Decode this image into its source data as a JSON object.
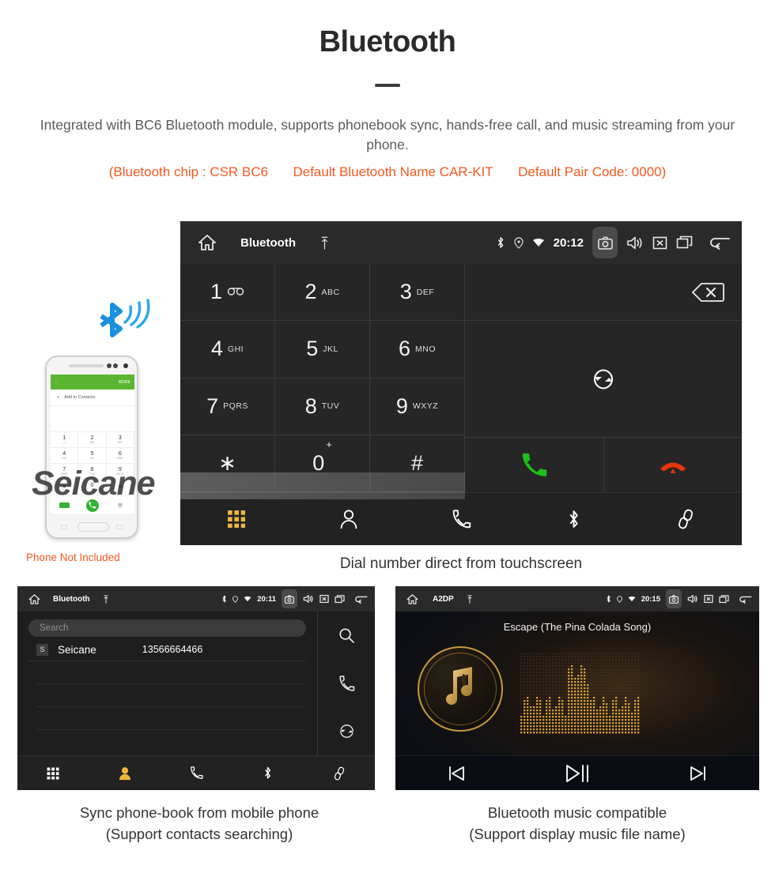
{
  "header": {
    "title": "Bluetooth",
    "description": "Integrated with BC6 Bluetooth module, supports phonebook sync, hands-free call, and music streaming from your phone.",
    "spec_chip": "(Bluetooth chip : CSR BC6",
    "spec_name": "Default Bluetooth Name CAR-KIT",
    "spec_code": "Default Pair Code: 0000)",
    "accent_color": "#f4581f",
    "title_color": "#2b2b2b"
  },
  "phone_mock": {
    "appbar_back": "←",
    "appbar_more": "MORE",
    "add_contacts": "Add to Contacts",
    "add_plus": "+",
    "keys": [
      {
        "num": "1",
        "sub": "∞"
      },
      {
        "num": "2",
        "sub": "ABC"
      },
      {
        "num": "3",
        "sub": "DEF"
      },
      {
        "num": "4",
        "sub": "GHI"
      },
      {
        "num": "5",
        "sub": "JKL"
      },
      {
        "num": "6",
        "sub": "MNO"
      },
      {
        "num": "7",
        "sub": "PQRS"
      },
      {
        "num": "8",
        "sub": "TUV"
      },
      {
        "num": "9",
        "sub": "WXYZ"
      },
      {
        "num": "∗",
        "sub": ""
      },
      {
        "num": "0",
        "sub": "+"
      },
      {
        "num": "#",
        "sub": ""
      }
    ],
    "not_included_note": "Phone Not Included",
    "bluetooth_wave_icon": "bluetooth-signal-icon"
  },
  "dialer": {
    "statusbar": {
      "home_icon": "home-icon",
      "title": "Bluetooth",
      "usb_icon": "usb-icon",
      "bluetooth_icon": "bluetooth-icon",
      "location_icon": "location-icon",
      "wifi_icon": "wifi-icon",
      "time": "20:12",
      "camera_icon": "camera-icon",
      "volume_icon": "volume-icon",
      "close_icon": "close-box-icon",
      "recents_icon": "recents-icon",
      "back_icon": "back-icon"
    },
    "keys": [
      {
        "num": "1",
        "sub": "",
        "voicemail": true
      },
      {
        "num": "2",
        "sub": "ABC"
      },
      {
        "num": "3",
        "sub": "DEF"
      },
      {
        "num": "4",
        "sub": "GHI"
      },
      {
        "num": "5",
        "sub": "JKL"
      },
      {
        "num": "6",
        "sub": "MNO"
      },
      {
        "num": "7",
        "sub": "PQRS"
      },
      {
        "num": "8",
        "sub": "TUV"
      },
      {
        "num": "9",
        "sub": "WXYZ"
      },
      {
        "num": "∗",
        "sub": ""
      },
      {
        "num": "0",
        "sup": "+"
      },
      {
        "num": "#",
        "sub": ""
      }
    ],
    "number_input_value": "",
    "backspace_icon": "backspace-icon",
    "sync_icon": "sync-icon",
    "call_icon": "call-icon",
    "hangup_icon": "hangup-icon",
    "call_color": "#18c018",
    "hangup_color": "#e8330c",
    "navbar": [
      {
        "icon": "keypad-icon",
        "active": true
      },
      {
        "icon": "contacts-icon",
        "active": false
      },
      {
        "icon": "call-log-icon",
        "active": false
      },
      {
        "icon": "bluetooth-icon",
        "active": false
      },
      {
        "icon": "link-icon",
        "active": false
      }
    ],
    "active_color": "#f0b63c",
    "watermark": "Seicane",
    "caption": "Dial number direct from touchscreen"
  },
  "phonebook": {
    "statusbar": {
      "home_icon": "home-icon",
      "title": "Bluetooth",
      "usb_icon": "usb-icon",
      "time": "20:11",
      "camera_icon": "camera-icon",
      "volume_icon": "volume-icon",
      "close_icon": "close-box-icon",
      "recents_icon": "recents-icon",
      "back_icon": "back-icon"
    },
    "search_placeholder": "Search",
    "search_value": "",
    "columns": [
      "name",
      "number"
    ],
    "contacts": [
      {
        "initial": "S",
        "name": "Seicane",
        "number": "13566664466"
      }
    ],
    "empty_rows": 3,
    "rail": [
      {
        "icon": "search-icon"
      },
      {
        "icon": "call-log-icon"
      },
      {
        "icon": "sync-icon"
      }
    ],
    "navbar": [
      {
        "icon": "keypad-icon",
        "active": false
      },
      {
        "icon": "contacts-icon",
        "active": true
      },
      {
        "icon": "call-log-icon",
        "active": false
      },
      {
        "icon": "bluetooth-icon",
        "active": false
      },
      {
        "icon": "link-icon",
        "active": false
      }
    ],
    "active_color": "#f0b63c",
    "caption_line1": "Sync phone-book from mobile phone",
    "caption_line2": "(Support contacts searching)"
  },
  "music": {
    "statusbar": {
      "home_icon": "home-icon",
      "title": "A2DP",
      "usb_icon": "usb-icon",
      "time": "20:15",
      "camera_icon": "camera-icon",
      "volume_icon": "volume-icon",
      "close_icon": "close-box-icon",
      "recents_icon": "recents-icon",
      "back_icon": "back-icon"
    },
    "track_title": "Escape (The Pina Colada Song)",
    "album_art_icon": "music-note-bluetooth-icon",
    "equalizer_icon": "dot-matrix-equalizer",
    "accent_color": "#c79a3c",
    "controls": [
      {
        "icon": "previous-icon"
      },
      {
        "icon": "play-pause-icon"
      },
      {
        "icon": "next-icon"
      }
    ],
    "caption_line1": "Bluetooth music compatible",
    "caption_line2": "(Support display music file name)"
  }
}
